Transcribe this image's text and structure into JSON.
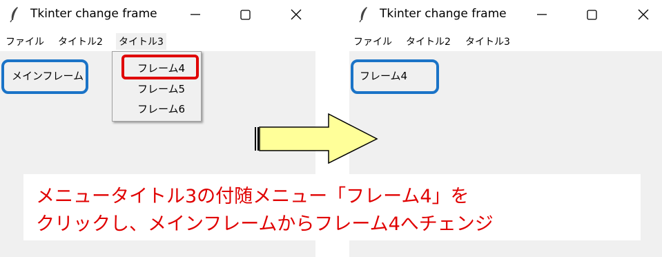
{
  "left_window": {
    "title": "Tkinter change frame",
    "menu": [
      "ファイル",
      "タイトル2",
      "タイトル3"
    ],
    "frame_label": "メインフレーム",
    "dropdown_items": [
      "フレーム4",
      "フレーム5",
      "フレーム6"
    ]
  },
  "right_window": {
    "title": "Tkinter change frame",
    "menu": [
      "ファイル",
      "タイトル2",
      "タイトル3"
    ],
    "frame_label": "フレーム4"
  },
  "caption": {
    "line1": "メニュータイトル3の付随メニュー「フレーム4」を",
    "line2": "クリックし、メインフレームからフレーム4へチェンジ"
  },
  "colors": {
    "highlight_blue": "#1a73c7",
    "highlight_red": "#e00000",
    "arrow_fill": "#ffff99"
  }
}
